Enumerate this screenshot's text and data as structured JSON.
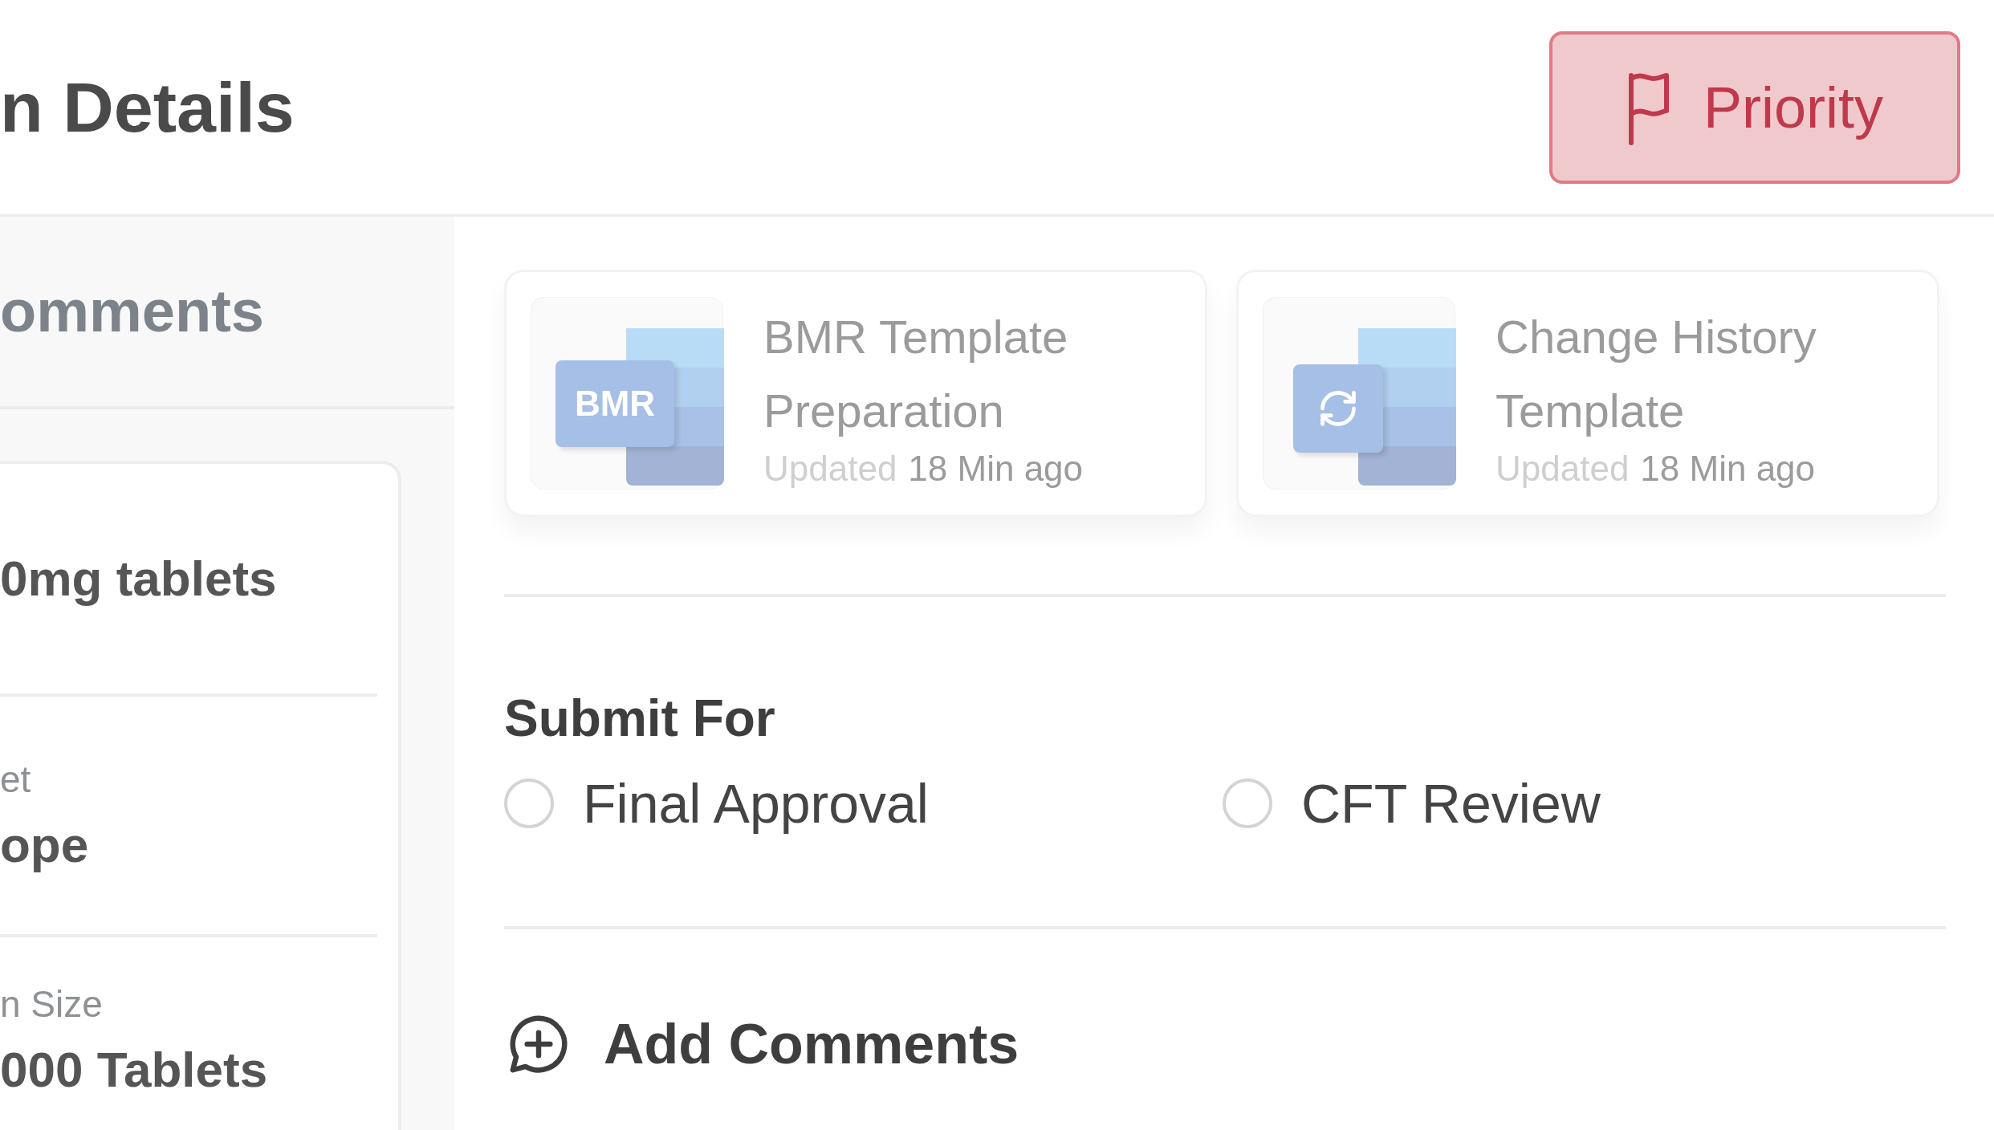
{
  "header": {
    "title": "n Details",
    "priority_button": {
      "label": "Priority"
    }
  },
  "left_panel": {
    "heading": "omments",
    "fields": [
      {
        "value": "0mg tablets"
      },
      {
        "label": "et",
        "value": "ope"
      },
      {
        "label": "n Size",
        "value": "000 Tablets"
      }
    ]
  },
  "templates": [
    {
      "kind": "bmr",
      "badge": "BMR",
      "title": "BMR Template Preparation",
      "updated_label": "Updated",
      "time": "18 Min ago"
    },
    {
      "kind": "sync",
      "title": "Change History Template",
      "updated_label": "Updated",
      "time": "18 Min ago"
    }
  ],
  "submit_for": {
    "heading": "Submit For",
    "options": [
      {
        "label": "Final Approval",
        "selected": false
      },
      {
        "label": "CFT Review",
        "selected": false
      }
    ]
  },
  "add_comments": {
    "label": "Add Comments"
  }
}
